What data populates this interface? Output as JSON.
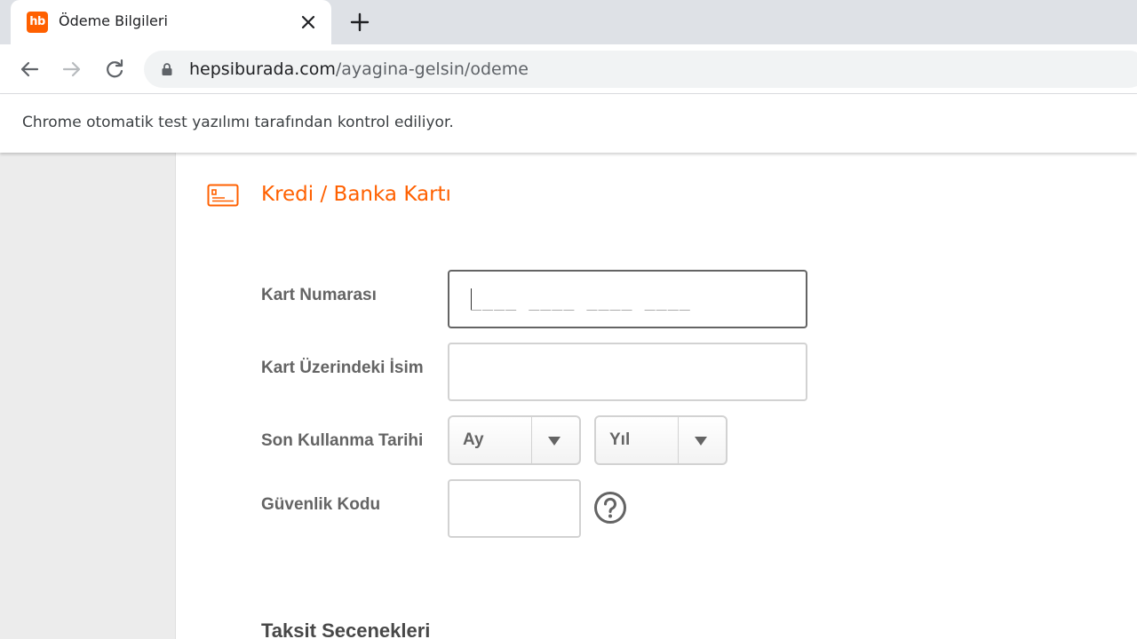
{
  "browser": {
    "tab": {
      "favicon_text": "hb",
      "title": "Ödeme Bilgileri"
    },
    "url": {
      "host": "hepsiburada.com",
      "path": "/ayagina-gelsin/odeme"
    },
    "infobar_text": "Chrome otomatik test yazılımı tarafından kontrol ediliyor."
  },
  "payment": {
    "title": "Kredi / Banka Kartı",
    "icon": "credit-card-icon",
    "fields": {
      "card_number_label": "Kart Numarası",
      "card_number_placeholder": "____ ____ ____ ____",
      "card_name_label": "Kart Üzerindeki İsim",
      "card_name_value": "",
      "expiry_label": "Son Kullanma Tarihi",
      "expiry_month": "Ay",
      "expiry_year": "Yıl",
      "cvv_label": "Güvenlik Kodu",
      "cvv_value": ""
    },
    "installments_title": "Taksit Secenekleri"
  },
  "colors": {
    "brand": "#ff6000",
    "label": "#646464",
    "border": "#d2d2d2"
  }
}
